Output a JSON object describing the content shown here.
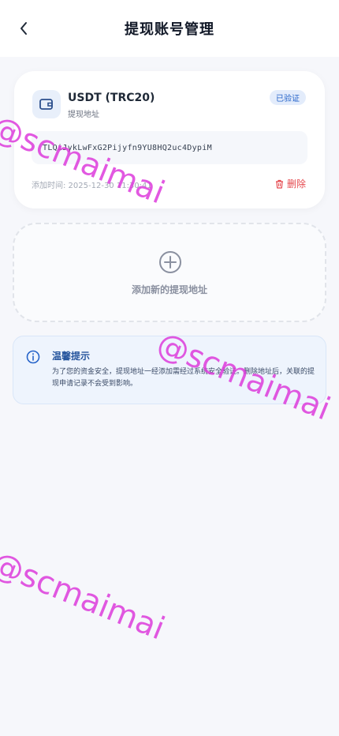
{
  "header": {
    "title": "提现账号管理"
  },
  "account": {
    "name": "USDT (TRC20)",
    "sub": "提现地址",
    "status": "已验证",
    "address": "TLQiJykLwFxG2Pijyfn9YU8HQ2uc4DypiM",
    "added_time": "添加时间: 2025-12-30 11:30:41",
    "delete_label": "删除"
  },
  "add": {
    "label": "添加新的提现地址"
  },
  "tip": {
    "title": "温馨提示",
    "text": "为了您的资金安全，提现地址一经添加需经过系统安全验证。删除地址后，关联的提现申请记录不会受到影响。"
  },
  "watermark": {
    "text": "@scmaimai"
  },
  "colors": {
    "accent": "#2563c9",
    "danger": "#e5484d",
    "watermark": "#dd3cdc"
  }
}
